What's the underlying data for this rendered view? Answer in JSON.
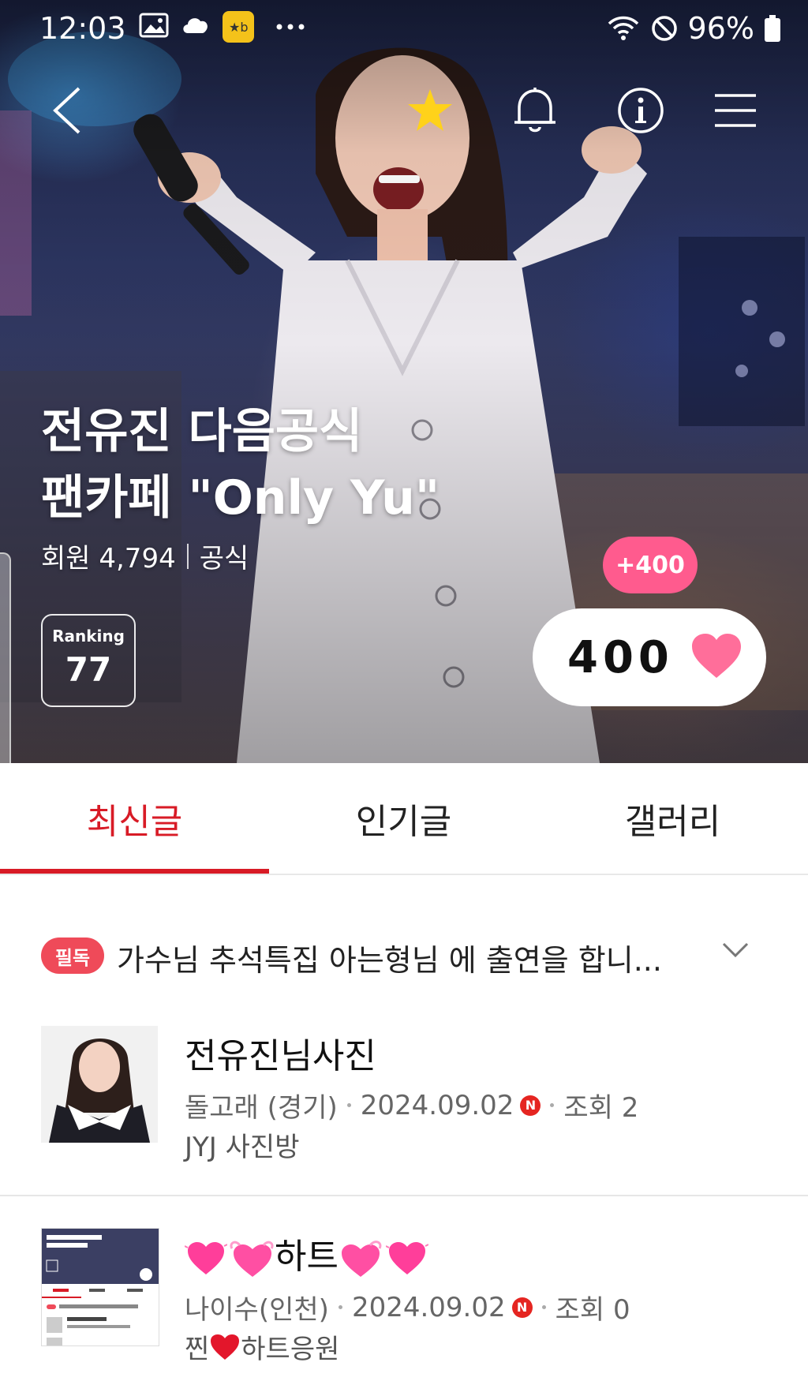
{
  "status_bar": {
    "time": "12:03",
    "battery": "96%"
  },
  "nav": {
    "back_icon": "chevron-left-icon",
    "favorite_icon": "star-icon",
    "notify_icon": "bell-icon",
    "info_icon": "info-icon",
    "menu_icon": "hamburger-menu-icon"
  },
  "cafe": {
    "title_line1": "전유진 다음공식",
    "title_line2": "팬카페 \"Only Yu\"",
    "members_label": "회원 4,794",
    "type_label": "공식",
    "ranking_label": "Ranking",
    "ranking_value": "77",
    "plus_badge": "+400",
    "heart_count": "400"
  },
  "tabs": [
    {
      "label": "최신글",
      "active": true
    },
    {
      "label": "인기글",
      "active": false
    },
    {
      "label": "갤러리",
      "active": false
    }
  ],
  "notice": {
    "badge": "필독",
    "text": "가수님 추석특집 아는형님 에 출연을 합니..."
  },
  "posts": [
    {
      "title": "전유진님사진",
      "author": "돌고래 (경기)",
      "date": "2024.09.02",
      "new_badge": "N",
      "views": "조회 2",
      "board": "JYJ 사진방"
    },
    {
      "title_text": "하트",
      "author": "나이수(인천)",
      "date": "2024.09.02",
      "new_badge": "N",
      "views": "조회 0",
      "board_prefix": "찐",
      "board_suffix": "하트응원"
    }
  ],
  "colors": {
    "accent": "#d81b26",
    "pink": "#ff5b8e",
    "heart": "#ff6e9a",
    "notice_badge": "#ef4a59",
    "new_badge": "#e52521"
  }
}
